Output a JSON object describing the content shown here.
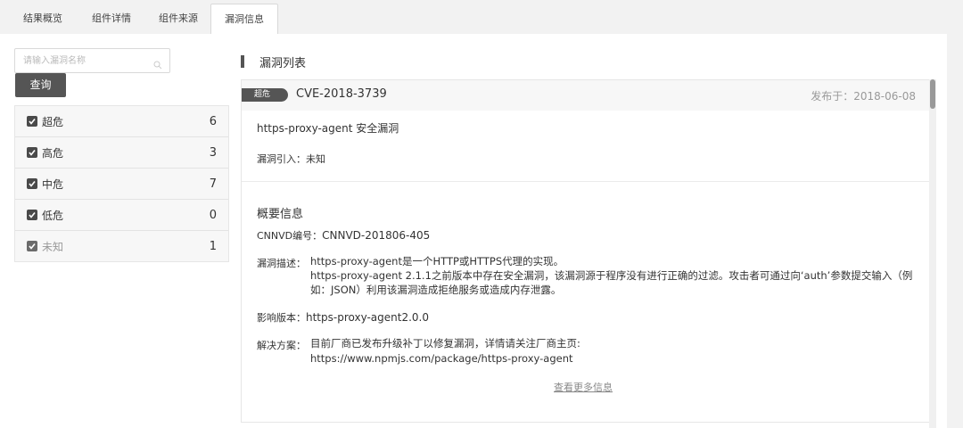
{
  "tabs": [
    {
      "label": "结果概览"
    },
    {
      "label": "组件详情"
    },
    {
      "label": "组件来源"
    },
    {
      "label": "漏洞信息",
      "active": true
    }
  ],
  "search": {
    "placeholder": "请输入漏洞名称",
    "value": "",
    "button_label": "查询"
  },
  "filters": [
    {
      "label": "超危",
      "count": "6",
      "checked": true
    },
    {
      "label": "高危",
      "count": "3",
      "checked": true
    },
    {
      "label": "中危",
      "count": "7",
      "checked": true
    },
    {
      "label": "低危",
      "count": "0",
      "checked": true
    },
    {
      "label": "未知",
      "count": "1",
      "checked": true,
      "muted": true
    }
  ],
  "vuln_list": {
    "title": "漏洞列表",
    "item": {
      "severity": "超危",
      "cve": "CVE-2018-3739",
      "published": "发布于：2018-06-08",
      "name": "https-proxy-agent 安全漏洞",
      "intro_label": "漏洞引入：",
      "intro_value": "未知",
      "summary_title": "概要信息",
      "cnnvd_label": "CNNVD编号：",
      "cnnvd_value": "CNNVD-201806-405",
      "desc_label": "漏洞描述：",
      "desc_line1": "https-proxy-agent是一个HTTP或HTTPS代理的实现。",
      "desc_line2": "https-proxy-agent 2.1.1之前版本中存在安全漏洞，该漏洞源于程序没有进行正确的过滤。攻击者可通过向‘auth’参数提交输入（例如：JSON）利用该漏洞造成拒绝服务或造成内存泄露。",
      "affected_label": "影响版本：",
      "affected_value": "https-proxy-agent2.0.0",
      "solution_label": "解决方案：",
      "solution_line1": "目前厂商已发布升级补丁以修复漏洞，详情请关注厂商主页:",
      "solution_line2": "https://www.npmjs.com/package/https-proxy-agent",
      "more_link": "查看更多信息"
    }
  },
  "colors": {
    "accent": "#555555",
    "muted": "#999999",
    "panel": "#f7f7f7"
  }
}
